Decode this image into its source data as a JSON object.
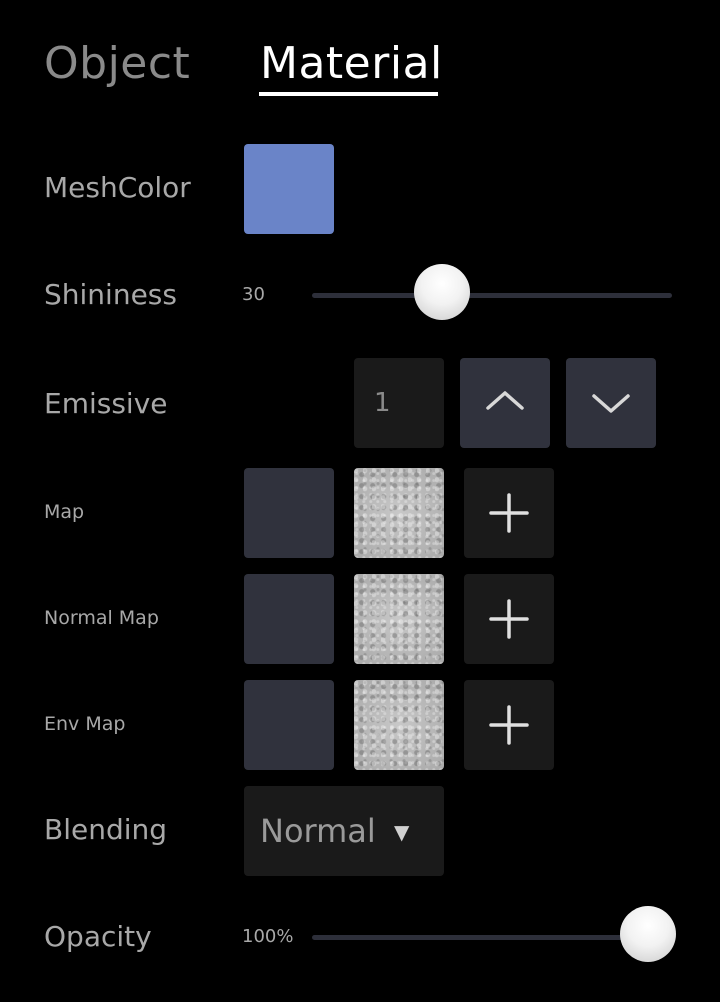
{
  "tabs": [
    {
      "label": "Object",
      "active": false
    },
    {
      "label": "Material",
      "active": true
    }
  ],
  "mesh_color": {
    "label": "MeshColor",
    "color": "#6a84c8"
  },
  "shininess": {
    "label": "Shininess",
    "value_text": "30",
    "value": 30,
    "fraction": 0.34
  },
  "emissive": {
    "label": "Emissive",
    "value": "1",
    "up_icon": "chevron-up-icon",
    "down_icon": "chevron-down-icon"
  },
  "maps": [
    {
      "label": "Map",
      "add_icon": "plus-icon"
    },
    {
      "label": "Normal Map",
      "add_icon": "plus-icon"
    },
    {
      "label": "Env Map",
      "add_icon": "plus-icon"
    }
  ],
  "blending": {
    "label": "Blending",
    "value": "Normal",
    "arrow": "▼"
  },
  "opacity": {
    "label": "Opacity",
    "value_text": "100%",
    "fraction": 1.0
  },
  "colors": {
    "background": "#000000",
    "active_tab": "#ffffff",
    "inactive_tab": "#8a8a8a",
    "slot": "#30323d",
    "box": "#1a1a1a",
    "track": "#2d2f3a"
  }
}
